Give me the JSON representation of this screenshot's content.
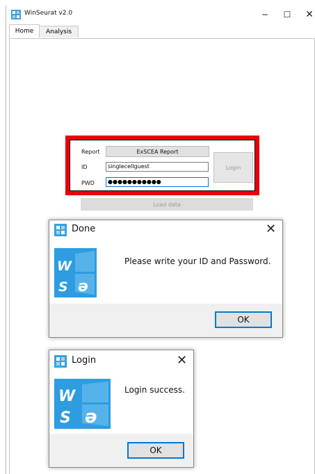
{
  "window": {
    "title": "WinSeurat v2.0",
    "controls": {
      "minimize": "−",
      "maximize": "☐",
      "close": "✕"
    }
  },
  "tabs": [
    {
      "label": "Home",
      "active": true
    },
    {
      "label": "Analysis",
      "active": false
    }
  ],
  "login_panel": {
    "report_label": "Report",
    "report_button": "ExSCEA Report",
    "id_label": "ID",
    "id_value": "singlecellguest",
    "pwd_label": "PWD",
    "pwd_value": "●●●●●●●●●●●",
    "login_button": "Login",
    "highlight_color": "#e8000b"
  },
  "load_data_button": "Load data",
  "done_dialog": {
    "title": "Done",
    "message": "Please write your ID and Password.",
    "ok_label": "OK",
    "close": "✕"
  },
  "login_dialog": {
    "title": "Login",
    "message": "Login success.",
    "ok_label": "OK",
    "close": "✕"
  },
  "colors": {
    "accent": "#0078d7",
    "logo_blue": "#3aa0e0"
  }
}
